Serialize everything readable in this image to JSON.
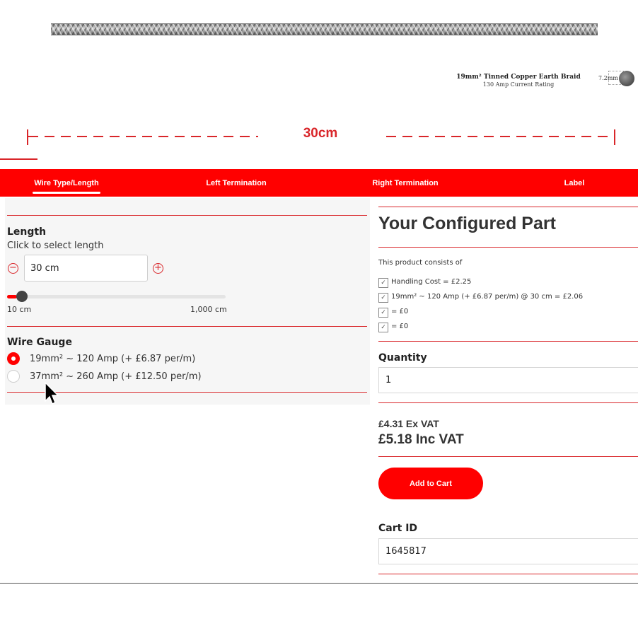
{
  "product": {
    "name": "19mm² Tinned Copper Earth Braid",
    "rating": "130 Amp Current Rating",
    "diameter": "7.2mm"
  },
  "dimension": {
    "length_label": "30cm"
  },
  "tabs": [
    {
      "label": "Wire Type/Length",
      "active": true
    },
    {
      "label": "Left Termination",
      "active": false
    },
    {
      "label": "Right Termination",
      "active": false
    },
    {
      "label": "Label",
      "active": false
    }
  ],
  "length": {
    "heading": "Length",
    "subtext": "Click to select length",
    "value": "30 cm",
    "decrement_icon": "minus-circle",
    "increment_icon": "plus-circle",
    "slider_min_label": "10 cm",
    "slider_max_label": "1,000 cm",
    "slider_fraction": 0.02
  },
  "wire_gauge": {
    "heading": "Wire Gauge",
    "options": [
      {
        "label": "19mm² ~ 120 Amp (+ £6.87 per/m)",
        "selected": true
      },
      {
        "label": "37mm² ~ 260 Amp (+ £12.50 per/m)",
        "selected": false
      }
    ]
  },
  "configured": {
    "title": "Your Configured Part",
    "consists_label": "This product consists of",
    "items": [
      "Handling Cost = £2.25",
      "19mm² ~ 120 Amp (+ £6.87 per/m) @ 30 cm = £2.06",
      " = £0",
      " = £0"
    ],
    "quantity_label": "Quantity",
    "quantity_value": "1",
    "price_ex_vat": "£4.31 Ex VAT",
    "price_inc_vat": "£5.18 Inc VAT",
    "add_to_cart": "Add to Cart",
    "cart_id_label": "Cart ID",
    "cart_id_value": "1645817"
  },
  "colors": {
    "accent": "#ff0000",
    "dimension": "#d9262a"
  }
}
